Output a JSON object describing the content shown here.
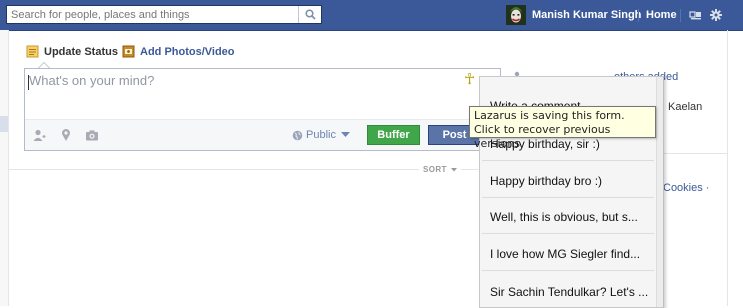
{
  "topbar": {
    "search_placeholder": "Search for people, places and things",
    "user_name": "Manish Kumar Singh",
    "home_label": "Home",
    "brand_color": "#3b5998"
  },
  "composer": {
    "tab_status": "Update Status",
    "tab_photo": "Add Photos/Video",
    "placeholder": "What's on your mind?",
    "audience": "Public",
    "buffer_label": "Buffer",
    "post_label": "Post",
    "icons": [
      "tag-friends-icon",
      "location-pin-icon",
      "camera-icon",
      "globe-icon",
      "ankh-icon"
    ]
  },
  "feed": {
    "sort_label": "SORT"
  },
  "right_column": {
    "fragment_1": "others added",
    "fragment_2": "Kaelan",
    "fragment_3": "Cookies ·"
  },
  "lazarus": {
    "items": [
      "Write a comment...",
      "Happy birthday, sir :)",
      "Happy birthday bro :)",
      "Well, this is obvious, but s...",
      "I love how MG Siegler find...",
      "Sir Sachin Tendulkar? Let's ..."
    ],
    "tooltip_line1": "Lazarus is saving this form.",
    "tooltip_line2": "Click to recover previous versions"
  }
}
